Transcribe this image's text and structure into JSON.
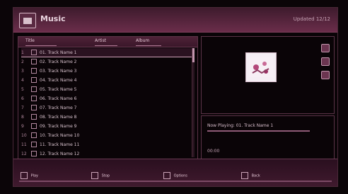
{
  "window": {
    "title": "Music",
    "status_text": "Updated 12/12"
  },
  "tabs": [
    "Title",
    "Artist",
    "Album"
  ],
  "list": {
    "items": [
      {
        "num": "1",
        "label": "01. Track Name 1"
      },
      {
        "num": "2",
        "label": "02. Track Name 2"
      },
      {
        "num": "3",
        "label": "03. Track Name 3"
      },
      {
        "num": "4",
        "label": "04. Track Name 4"
      },
      {
        "num": "5",
        "label": "05. Track Name 5"
      },
      {
        "num": "6",
        "label": "06. Track Name 6"
      },
      {
        "num": "7",
        "label": "07. Track Name 7"
      },
      {
        "num": "8",
        "label": "08. Track Name 8"
      },
      {
        "num": "9",
        "label": "09. Track Name 9"
      },
      {
        "num": "10",
        "label": "10. Track Name 10"
      },
      {
        "num": "11",
        "label": "11. Track Name 11"
      },
      {
        "num": "12",
        "label": "12. Track Name 12"
      }
    ],
    "selected_index": 0
  },
  "details": {
    "info_line": "Now Playing: 01. Track Name 1",
    "info_small": "00:00"
  },
  "bottom": {
    "buttons": [
      "Play",
      "Stop",
      "Options",
      "Back"
    ]
  }
}
